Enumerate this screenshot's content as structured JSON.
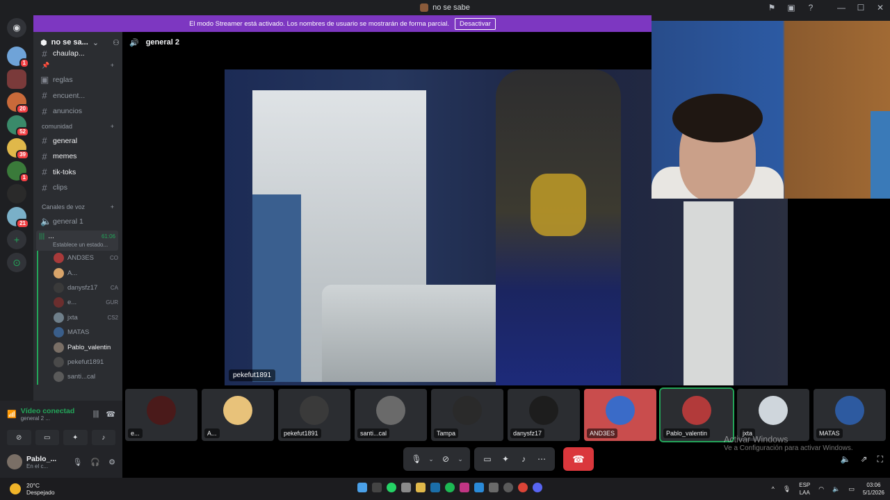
{
  "window": {
    "title": "no se sabe",
    "controls": [
      "⚑",
      "▣",
      "?",
      "—",
      "☐",
      "✕"
    ]
  },
  "streamer_banner": {
    "text": "El modo Streamer está activado. Los nombres de usuario se mostrarán de forma parcial.",
    "button": "Desactivar"
  },
  "guild_badges": [
    "1",
    "",
    "20",
    "52",
    "39",
    "1",
    "",
    "21"
  ],
  "server": {
    "name": "no se sa...",
    "channels": [
      {
        "name": "chaulap...",
        "bright": true
      },
      {
        "name": "reglas"
      },
      {
        "name": "encuent..."
      },
      {
        "name": "anuncios"
      }
    ],
    "category_comunidad": "comunidad",
    "community_channels": [
      {
        "name": "general",
        "bright": true
      },
      {
        "name": "memes",
        "bright": true
      },
      {
        "name": "tik-toks",
        "bright": true
      },
      {
        "name": "clips"
      }
    ],
    "category_voice": "Canales de voz",
    "voice_channel_1": "general 1",
    "active_voice": {
      "name": "...",
      "timer": "61:06",
      "status": "Establece un estado..."
    }
  },
  "voice_users": [
    {
      "name": "AND3ES",
      "extra": "CO",
      "color": "#a83a3a"
    },
    {
      "name": "A...",
      "extra": "",
      "color": "#d8a46a"
    },
    {
      "name": "danysfz17",
      "extra": "CA",
      "color": "#3a3a3a"
    },
    {
      "name": "e...",
      "extra": "GUR",
      "color": "#6b2e2e"
    },
    {
      "name": "jxta",
      "extra": "CS2",
      "color": "#6f7f8a"
    },
    {
      "name": "MATAS",
      "extra": "",
      "color": "#3a5e8a"
    },
    {
      "name": "Pablo_valentin",
      "extra": "",
      "color": "#7a6f66",
      "bright": true
    },
    {
      "name": "pekefut1891",
      "extra": "",
      "color": "#4a4a4a"
    },
    {
      "name": "santi...cal",
      "extra": "",
      "color": "#5a5a5a"
    }
  ],
  "voice_panel": {
    "status": "Vídeo conectad",
    "channel": "general 2 ..."
  },
  "me": {
    "name": "Pablo_...",
    "sub": "En el c..."
  },
  "stage": {
    "channel": "general 2",
    "main_label": "pekefut1891"
  },
  "tiles": [
    {
      "name": "e...",
      "color": "#4a1a1a"
    },
    {
      "name": "A...",
      "color": "#e8c27a"
    },
    {
      "name": "pekefut1891",
      "color": "#3a3a3a"
    },
    {
      "name": "santi...cal",
      "color": "#6a6a6a"
    },
    {
      "name": "Tampa",
      "color": "#2a2a2a"
    },
    {
      "name": "danysfz17",
      "color": "#1d1d1d"
    },
    {
      "name": "AND3ES",
      "color": "#3a6bc8"
    },
    {
      "name": "Pablo_valentin",
      "color": "#b23a3a"
    },
    {
      "name": "jxta",
      "color": "#cfd6dc"
    },
    {
      "name": "MATAS",
      "color": "#2d5aa0"
    }
  ],
  "watermark": {
    "line1": "Activar Windows",
    "line2": "Ve a Configuración para activar Windows."
  },
  "taskbar": {
    "temp": "20°C",
    "weather": "Despejado",
    "lang1": "ESP",
    "lang2": "LAA",
    "time": "03:06",
    "date": "5/1/2026"
  }
}
